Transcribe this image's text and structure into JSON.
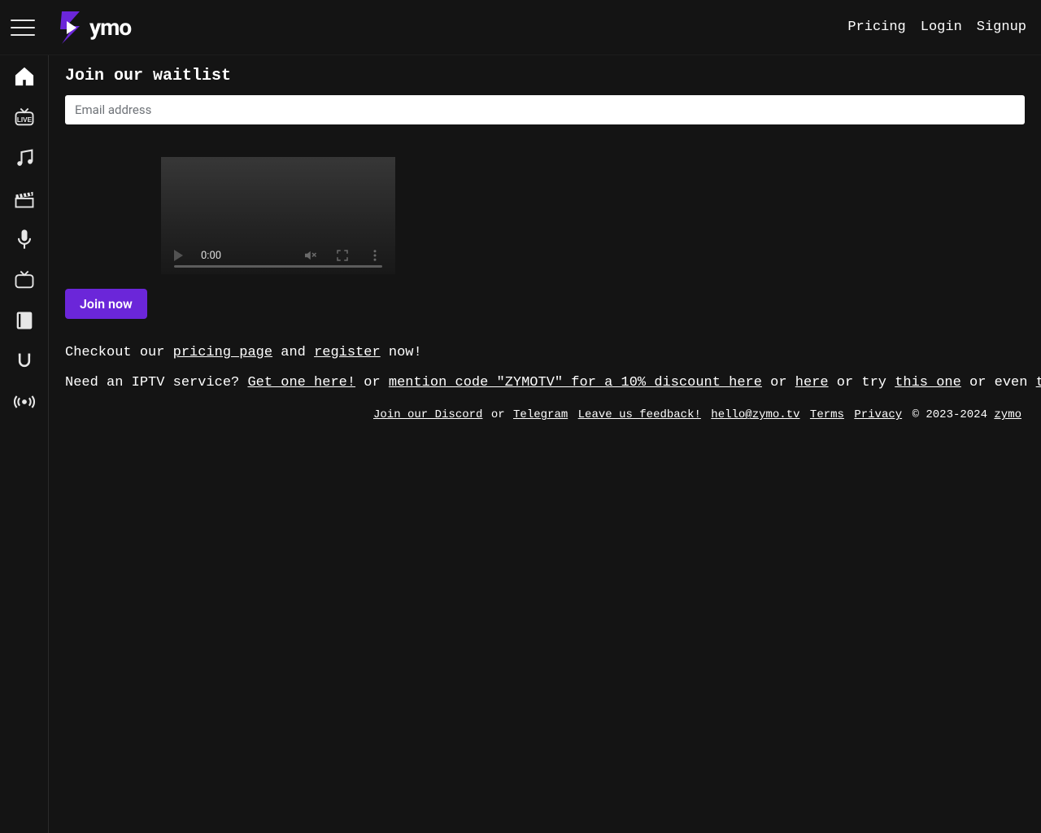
{
  "brand": {
    "name": "ymo",
    "accent": "#6b26d9"
  },
  "header": {
    "hamburger_name": "menu-icon",
    "links": {
      "pricing": "Pricing",
      "login": "Login",
      "signup": "Signup"
    }
  },
  "sidebar": {
    "items": [
      {
        "name": "home-icon"
      },
      {
        "name": "live-icon",
        "badge": "LIVE"
      },
      {
        "name": "music-icon"
      },
      {
        "name": "movies-icon"
      },
      {
        "name": "mic-icon"
      },
      {
        "name": "tv-icon"
      },
      {
        "name": "book-icon"
      },
      {
        "name": "magnet-icon"
      },
      {
        "name": "broadcast-icon"
      }
    ]
  },
  "waitlist": {
    "heading": "Join our waitlist",
    "email_placeholder": "Email address",
    "video_time": "0:00",
    "join_label": "Join now"
  },
  "pitch": {
    "checkout_prefix": "Checkout our ",
    "pricing_link": "pricing page",
    "and": " and ",
    "register_link": "register",
    "now_suffix": " now!",
    "iptv_prefix": "Need an IPTV service? ",
    "get_one": "Get one here!",
    "or1": " or ",
    "mention": "mention code \"ZYMOTV\" for a 10% discount here",
    "or2": " or ",
    "here2": "here",
    "or_try": " or try ",
    "this_one": "this one",
    "or_even": " or even ",
    "truncated": "t"
  },
  "footer": {
    "discord": "Join our Discord",
    "or": " or ",
    "telegram": "Telegram",
    "feedback": "Leave us feedback!",
    "email": "hello@zymo.tv",
    "terms": "Terms",
    "privacy": "Privacy",
    "copyright": "© 2023-2024 ",
    "zymo": "zymo"
  }
}
